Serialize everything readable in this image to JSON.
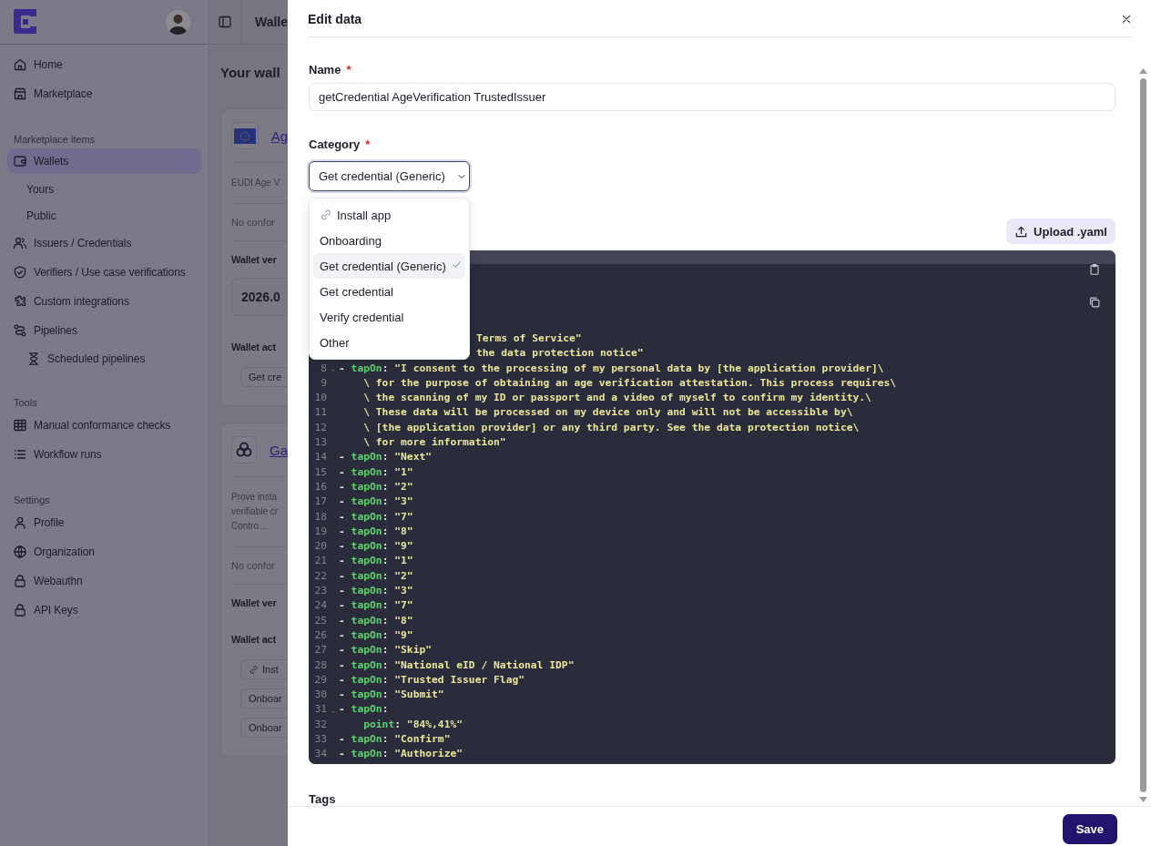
{
  "sidebar": {
    "sections": [
      {
        "items": [
          {
            "label": "Home",
            "selected": false
          },
          {
            "label": "Marketplace",
            "selected": false
          }
        ]
      },
      {
        "title": "Marketplace items",
        "items": [
          {
            "label": "Wallets",
            "selected": true,
            "children": [
              {
                "label": "Yours",
                "selected": false
              },
              {
                "label": "Public",
                "selected": false
              }
            ]
          },
          {
            "label": "Issuers / Credentials",
            "selected": false
          },
          {
            "label": "Verifiers / Use case verifications",
            "selected": false
          },
          {
            "label": "Custom integrations",
            "selected": false
          },
          {
            "label": "Pipelines",
            "selected": false,
            "children": [
              {
                "label": "Scheduled pipelines",
                "selected": false
              }
            ]
          }
        ]
      },
      {
        "title": "Tools",
        "items": [
          {
            "label": "Manual conformance checks",
            "selected": false
          },
          {
            "label": "Workflow runs",
            "selected": false
          }
        ]
      },
      {
        "title": "Settings",
        "items": [
          {
            "label": "Profile",
            "selected": false
          },
          {
            "label": "Organization",
            "selected": false
          },
          {
            "label": "Webauthn",
            "selected": false
          },
          {
            "label": "API Keys",
            "selected": false
          }
        ]
      }
    ]
  },
  "background": {
    "header_title": "Walle",
    "page_title": "Your wall",
    "cards": [
      {
        "name": "Ag",
        "lines": [
          "EUDI Age V"
        ],
        "empty": "No confor",
        "versions_label": "Wallet ver",
        "version": "2026.0",
        "actions_label": "Wallet act",
        "chips": [
          "Get cre"
        ]
      },
      {
        "name": "Ga",
        "lines": [
          "Prove insta",
          "verifiable cr",
          "Contro…"
        ],
        "empty": "No confor",
        "versions_label": "Wallet ver",
        "actions_label": "Wallet act",
        "chips": [
          "Inst",
          "Onboar",
          "Onboar"
        ]
      }
    ]
  },
  "sheet": {
    "title": "Edit data",
    "name_field": {
      "label": "Name",
      "required_mark": "*",
      "value": "getCredential AgeVerification TrustedIssuer"
    },
    "category_field": {
      "label": "Category",
      "required_mark": "*",
      "value": "Get credential (Generic)",
      "options": [
        {
          "label": "Install app",
          "selected": false
        },
        {
          "label": "Onboarding",
          "selected": false
        },
        {
          "label": "Get credential (Generic)",
          "selected": true
        },
        {
          "label": "Get credential",
          "selected": false
        },
        {
          "label": "Verify credential",
          "selected": false
        },
        {
          "label": "Other",
          "selected": false
        }
      ]
    },
    "upload_button": "Upload .yaml",
    "code_lines": [
      {
        "kind": "partial",
        "parts": [
          {
            "text": "Terms of Service\"",
            "kind": "string"
          }
        ]
      },
      {
        "kind": "partial",
        "parts": [
          {
            "text": "the data protection notice\"",
            "kind": "string"
          }
        ]
      },
      {
        "num": "8",
        "fold": true,
        "parts": [
          {
            "text": "- ",
            "kind": "plain"
          },
          {
            "text": "tapOn",
            "kind": "key"
          },
          {
            "text": ": ",
            "kind": "plain"
          },
          {
            "text": "\"I consent to the processing of my personal data by [the application provider]\\",
            "kind": "string"
          }
        ]
      },
      {
        "num": "9",
        "parts": [
          {
            "text": "    \\ for the purpose of obtaining an age verification attestation. This process requires\\",
            "kind": "string"
          }
        ]
      },
      {
        "num": "10",
        "parts": [
          {
            "text": "    \\ the scanning of my ID or passport and a video of myself to confirm my identity.\\",
            "kind": "string"
          }
        ]
      },
      {
        "num": "11",
        "parts": [
          {
            "text": "    \\ These data will be processed on my device only and will not be accessible by\\",
            "kind": "string"
          }
        ]
      },
      {
        "num": "12",
        "parts": [
          {
            "text": "    \\ [the application provider] or any third party. See the data protection notice\\",
            "kind": "string"
          }
        ]
      },
      {
        "num": "13",
        "parts": [
          {
            "text": "    \\ for more information\"",
            "kind": "string"
          }
        ]
      },
      {
        "num": "14",
        "parts": [
          {
            "text": "- ",
            "kind": "plain"
          },
          {
            "text": "tapOn",
            "kind": "key"
          },
          {
            "text": ": ",
            "kind": "plain"
          },
          {
            "text": "\"Next\"",
            "kind": "string"
          }
        ]
      },
      {
        "num": "15",
        "parts": [
          {
            "text": "- ",
            "kind": "plain"
          },
          {
            "text": "tapOn",
            "kind": "key"
          },
          {
            "text": ": ",
            "kind": "plain"
          },
          {
            "text": "\"1\"",
            "kind": "string"
          }
        ]
      },
      {
        "num": "16",
        "parts": [
          {
            "text": "- ",
            "kind": "plain"
          },
          {
            "text": "tapOn",
            "kind": "key"
          },
          {
            "text": ": ",
            "kind": "plain"
          },
          {
            "text": "\"2\"",
            "kind": "string"
          }
        ]
      },
      {
        "num": "17",
        "parts": [
          {
            "text": "- ",
            "kind": "plain"
          },
          {
            "text": "tapOn",
            "kind": "key"
          },
          {
            "text": ": ",
            "kind": "plain"
          },
          {
            "text": "\"3\"",
            "kind": "string"
          }
        ]
      },
      {
        "num": "18",
        "parts": [
          {
            "text": "- ",
            "kind": "plain"
          },
          {
            "text": "tapOn",
            "kind": "key"
          },
          {
            "text": ": ",
            "kind": "plain"
          },
          {
            "text": "\"7\"",
            "kind": "string"
          }
        ]
      },
      {
        "num": "19",
        "parts": [
          {
            "text": "- ",
            "kind": "plain"
          },
          {
            "text": "tapOn",
            "kind": "key"
          },
          {
            "text": ": ",
            "kind": "plain"
          },
          {
            "text": "\"8\"",
            "kind": "string"
          }
        ]
      },
      {
        "num": "20",
        "parts": [
          {
            "text": "- ",
            "kind": "plain"
          },
          {
            "text": "tapOn",
            "kind": "key"
          },
          {
            "text": ": ",
            "kind": "plain"
          },
          {
            "text": "\"9\"",
            "kind": "string"
          }
        ]
      },
      {
        "num": "21",
        "parts": [
          {
            "text": "- ",
            "kind": "plain"
          },
          {
            "text": "tapOn",
            "kind": "key"
          },
          {
            "text": ": ",
            "kind": "plain"
          },
          {
            "text": "\"1\"",
            "kind": "string"
          }
        ]
      },
      {
        "num": "22",
        "parts": [
          {
            "text": "- ",
            "kind": "plain"
          },
          {
            "text": "tapOn",
            "kind": "key"
          },
          {
            "text": ": ",
            "kind": "plain"
          },
          {
            "text": "\"2\"",
            "kind": "string"
          }
        ]
      },
      {
        "num": "23",
        "parts": [
          {
            "text": "- ",
            "kind": "plain"
          },
          {
            "text": "tapOn",
            "kind": "key"
          },
          {
            "text": ": ",
            "kind": "plain"
          },
          {
            "text": "\"3\"",
            "kind": "string"
          }
        ]
      },
      {
        "num": "24",
        "parts": [
          {
            "text": "- ",
            "kind": "plain"
          },
          {
            "text": "tapOn",
            "kind": "key"
          },
          {
            "text": ": ",
            "kind": "plain"
          },
          {
            "text": "\"7\"",
            "kind": "string"
          }
        ]
      },
      {
        "num": "25",
        "parts": [
          {
            "text": "- ",
            "kind": "plain"
          },
          {
            "text": "tapOn",
            "kind": "key"
          },
          {
            "text": ": ",
            "kind": "plain"
          },
          {
            "text": "\"8\"",
            "kind": "string"
          }
        ]
      },
      {
        "num": "26",
        "parts": [
          {
            "text": "- ",
            "kind": "plain"
          },
          {
            "text": "tapOn",
            "kind": "key"
          },
          {
            "text": ": ",
            "kind": "plain"
          },
          {
            "text": "\"9\"",
            "kind": "string"
          }
        ]
      },
      {
        "num": "27",
        "parts": [
          {
            "text": "- ",
            "kind": "plain"
          },
          {
            "text": "tapOn",
            "kind": "key"
          },
          {
            "text": ": ",
            "kind": "plain"
          },
          {
            "text": "\"Skip\"",
            "kind": "string"
          }
        ]
      },
      {
        "num": "28",
        "parts": [
          {
            "text": "- ",
            "kind": "plain"
          },
          {
            "text": "tapOn",
            "kind": "key"
          },
          {
            "text": ": ",
            "kind": "plain"
          },
          {
            "text": "\"National eID / National IDP\"",
            "kind": "string"
          }
        ]
      },
      {
        "num": "29",
        "parts": [
          {
            "text": "- ",
            "kind": "plain"
          },
          {
            "text": "tapOn",
            "kind": "key"
          },
          {
            "text": ": ",
            "kind": "plain"
          },
          {
            "text": "\"Trusted Issuer Flag\"",
            "kind": "string"
          }
        ]
      },
      {
        "num": "30",
        "parts": [
          {
            "text": "- ",
            "kind": "plain"
          },
          {
            "text": "tapOn",
            "kind": "key"
          },
          {
            "text": ": ",
            "kind": "plain"
          },
          {
            "text": "\"Submit\"",
            "kind": "string"
          }
        ]
      },
      {
        "num": "31",
        "fold": true,
        "parts": [
          {
            "text": "- ",
            "kind": "plain"
          },
          {
            "text": "tapOn",
            "kind": "key"
          },
          {
            "text": ":",
            "kind": "plain"
          }
        ]
      },
      {
        "num": "32",
        "parts": [
          {
            "text": "    point",
            "kind": "key"
          },
          {
            "text": ": ",
            "kind": "plain"
          },
          {
            "text": "\"84%,41%\"",
            "kind": "string"
          }
        ]
      },
      {
        "num": "33",
        "parts": [
          {
            "text": "- ",
            "kind": "plain"
          },
          {
            "text": "tapOn",
            "kind": "key"
          },
          {
            "text": ": ",
            "kind": "plain"
          },
          {
            "text": "\"Confirm\"",
            "kind": "string"
          }
        ]
      },
      {
        "num": "34",
        "parts": [
          {
            "text": "- ",
            "kind": "plain"
          },
          {
            "text": "tapOn",
            "kind": "key"
          },
          {
            "text": ": ",
            "kind": "plain"
          },
          {
            "text": "\"Authorize\"",
            "kind": "string"
          }
        ]
      }
    ],
    "tags_label": "Tags",
    "save_button": "Save"
  }
}
